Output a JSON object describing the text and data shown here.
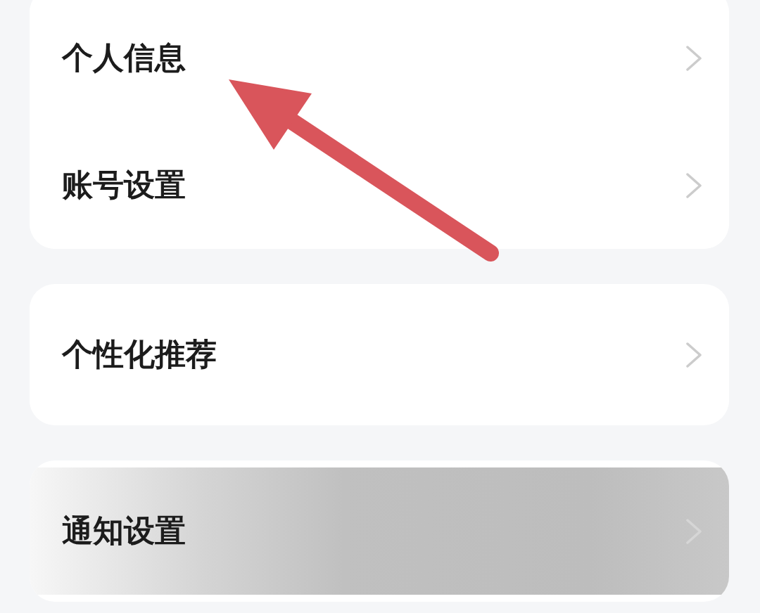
{
  "groups": [
    {
      "items": [
        {
          "label": "个人信息",
          "pressed": false
        },
        {
          "label": "账号设置",
          "pressed": false
        }
      ]
    },
    {
      "items": [
        {
          "label": "个性化推荐",
          "pressed": false
        }
      ]
    },
    {
      "items": [
        {
          "label": "通知设置",
          "pressed": true
        }
      ]
    }
  ]
}
